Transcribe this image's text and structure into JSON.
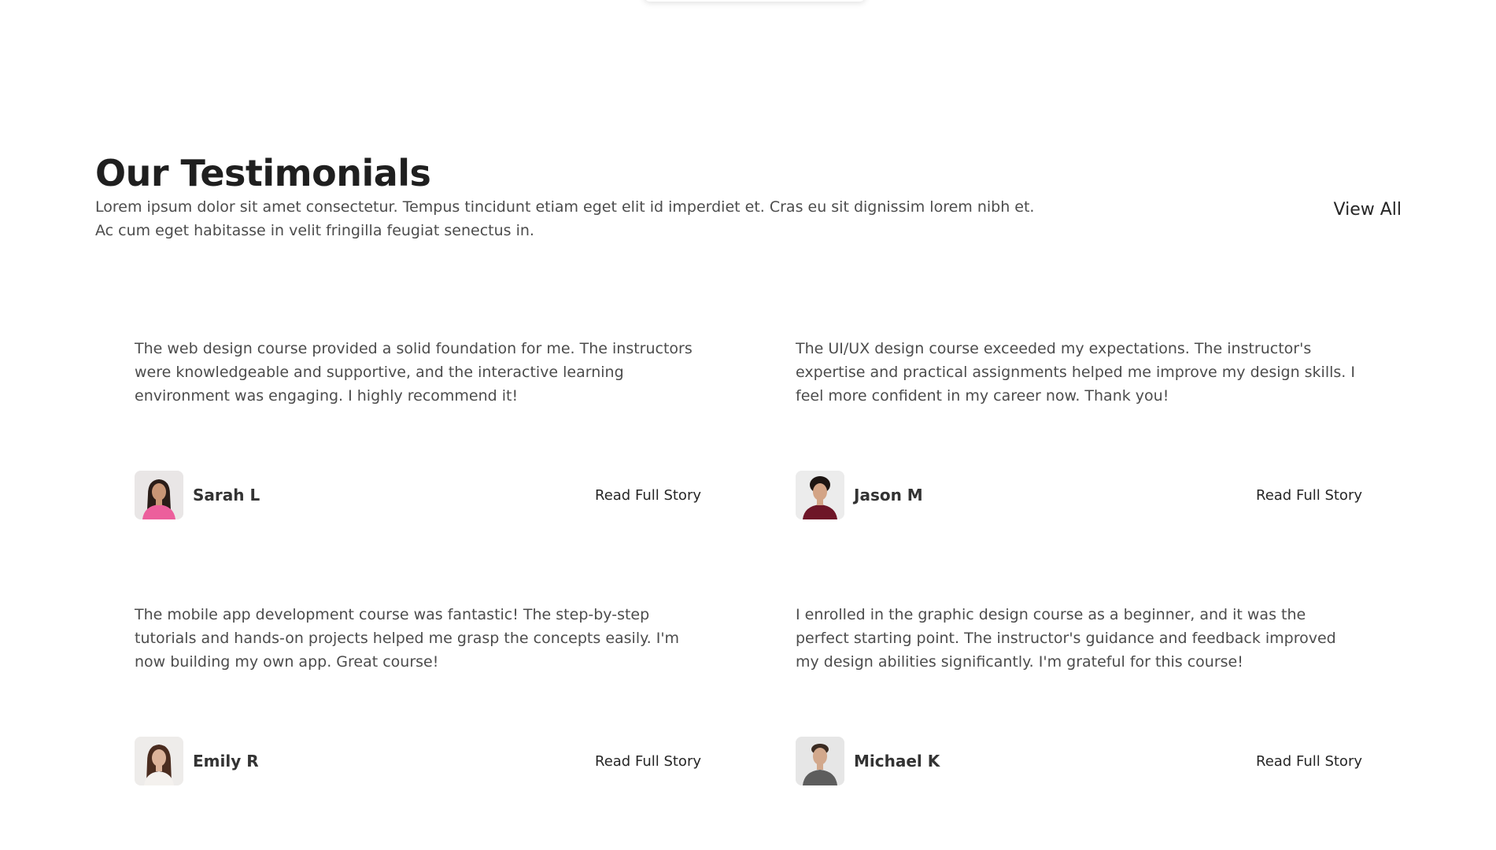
{
  "header": {
    "title": "Our Testimonials",
    "description_line1": "Lorem ipsum dolor sit amet consectetur. Tempus tincidunt etiam eget elit id imperdiet et. Cras eu sit dignissim lorem nibh et.",
    "description_line2": "Ac cum eget habitasse in velit fringilla feugiat senectus in.",
    "view_all_label": "View All"
  },
  "testimonials": [
    {
      "text": "The web design course provided a solid foundation for me. The instructors were knowledgeable and supportive, and the interactive learning environment was engaging. I highly recommend it!",
      "author": "Sarah L",
      "cta": "Read Full Story"
    },
    {
      "text": "The UI/UX design course exceeded my expectations. The instructor's expertise and practical assignments helped me improve my design skills. I feel more confident in my career now. Thank you!",
      "author": "Jason M",
      "cta": "Read Full Story"
    },
    {
      "text": "The mobile app development course was fantastic! The step-by-step tutorials and hands-on projects helped me grasp the concepts easily. I'm now building my own app. Great course!",
      "author": "Emily R",
      "cta": "Read Full Story"
    },
    {
      "text": "I enrolled in the graphic design course as a beginner, and it was the perfect starting point. The instructor's guidance and feedback improved my design abilities significantly. I'm grateful for this course!",
      "author": "Michael K",
      "cta": "Read Full Story"
    }
  ]
}
